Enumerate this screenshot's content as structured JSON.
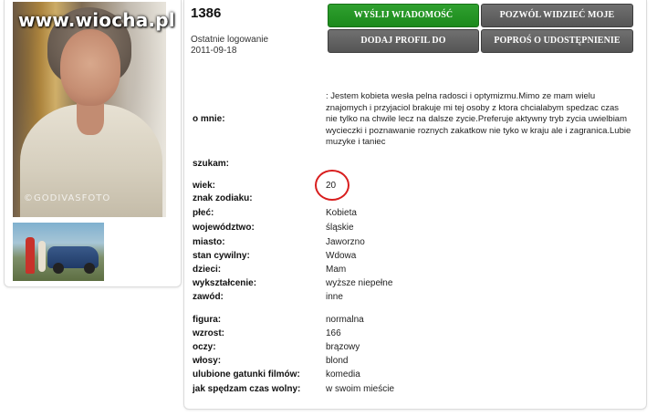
{
  "watermark": "www.wiocha.pl",
  "photo_stamp": "©GODIVASFOTO",
  "profile": {
    "id": "1386",
    "last_login_label": "Ostatnie logowanie",
    "last_login_date": "2011-09-18"
  },
  "buttons": {
    "send_message": "WYŚLIJ WIADOMOŚĆ",
    "allow_photos": "POZWÓL WIDZIEĆ MOJE ZDJĘCIA",
    "add_favorite": "DODAJ PROFIL DO ULUBIONYCH",
    "request_photos": "POPROŚ O UDOSTĘPNIENIE ZDJĘĆ"
  },
  "fields": {
    "about_label": "o mnie:",
    "about_value": ": Jestem kobieta wesła pelna radosci i optymizmu.Mimo ze mam wielu znajomych i przyjaciol brakuje mi tej osoby z ktora chcialabym spedzac czas nie tylko na chwile lecz na dalsze zycie.Preferuje aktywny tryb zycia uwielbiam wycieczki i poznawanie roznych zakatkow nie tyko w kraju ale i zagranica.Lubie muzyke i taniec",
    "seeking_label": "szukam:",
    "age_label": "wiek:",
    "age_value": "20",
    "zodiac_label": "znak zodiaku:",
    "sex_label": "płeć:",
    "sex_value": "Kobieta",
    "province_label": "województwo:",
    "province_value": "śląskie",
    "city_label": "miasto:",
    "city_value": "Jaworzno",
    "marital_label": "stan cywilny:",
    "marital_value": "Wdowa",
    "children_label": "dzieci:",
    "children_value": "Mam",
    "education_label": "wykształcenie:",
    "education_value": "wyższe niepełne",
    "job_label": "zawód:",
    "job_value": "inne",
    "figure_label": "figura:",
    "figure_value": "normalna",
    "height_label": "wzrost:",
    "height_value": "166",
    "eyes_label": "oczy:",
    "eyes_value": "brązowy",
    "hair_label": "włosy:",
    "hair_value": "blond",
    "films_label": "ulubione gatunki filmów:",
    "films_value": "komedia",
    "freetime_label": "jak spędzam czas wolny:",
    "freetime_value": "w swoim mieście"
  },
  "colors": {
    "primary_button": "#1f8f1f",
    "secondary_button": "#5a5a5a",
    "highlight_circle": "#d81e1e"
  }
}
